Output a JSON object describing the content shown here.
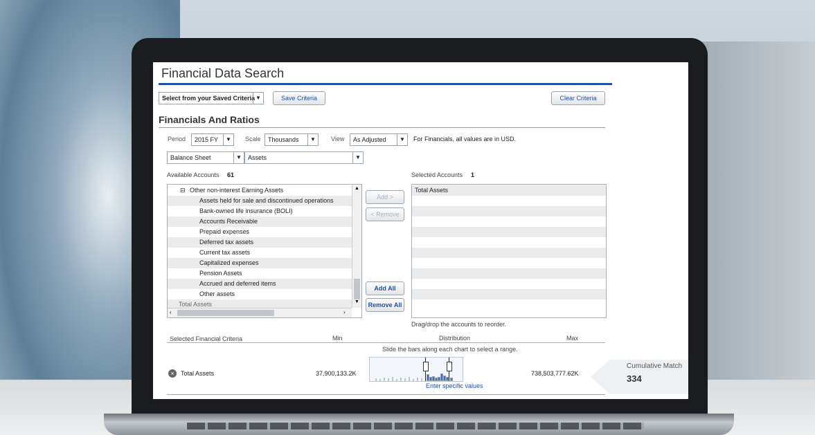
{
  "page": {
    "title": "Financial Data Search"
  },
  "criteria_bar": {
    "saved_select": "Select from your Saved Criteria",
    "save_button": "Save Criteria",
    "clear_button": "Clear Criteria"
  },
  "section_title": "Financials And Ratios",
  "filters": {
    "period_label": "Period",
    "period_value": "2015 FY",
    "scale_label": "Scale",
    "scale_value": "Thousands",
    "view_label": "View",
    "view_value": "As Adjusted",
    "note": "For Financials, all values are in USD.",
    "statement_value": "Balance Sheet",
    "category_value": "Assets"
  },
  "available": {
    "label": "Available Accounts",
    "count": "61",
    "group": "Other non-interest Earning Assets",
    "items": [
      "Assets held for sale and discontinued operations",
      "Bank-owned life insurance (BOLI)",
      "Accounts Receivable",
      "Prepaid expenses",
      "Deferred tax assets",
      "Current tax assets",
      "Capitalized expenses",
      "Pension Assets",
      "Accrued and deferred items",
      "Other assets"
    ],
    "footer": "Total Assets"
  },
  "actions": {
    "add": "Add >",
    "remove": "< Remove",
    "add_all": "Add All",
    "remove_all": "Remove All"
  },
  "selected": {
    "label": "Selected Accounts",
    "count": "1",
    "items": [
      "Total Assets"
    ],
    "hint": "Drag/drop the accounts to reorder."
  },
  "criteria": {
    "headers": {
      "name": "Selected Financial Criteria",
      "min": "Min",
      "dist": "Distribution",
      "max": "Max"
    },
    "instruction": "Slide the bars along each chart to select a range.",
    "row": {
      "name": "Total Assets",
      "min": "37,900,133.2K",
      "max": "738,503,777.62K",
      "link": "Enter specific values"
    }
  },
  "cumulative": {
    "label": "Cumulative Match",
    "value": "334"
  },
  "icons": {
    "remove": "close-circle-icon",
    "dropdown": "chevron-down-icon",
    "collapse": "minus-box-icon"
  },
  "colors": {
    "accent": "#1f4fa8",
    "link": "#1f4fa8"
  }
}
